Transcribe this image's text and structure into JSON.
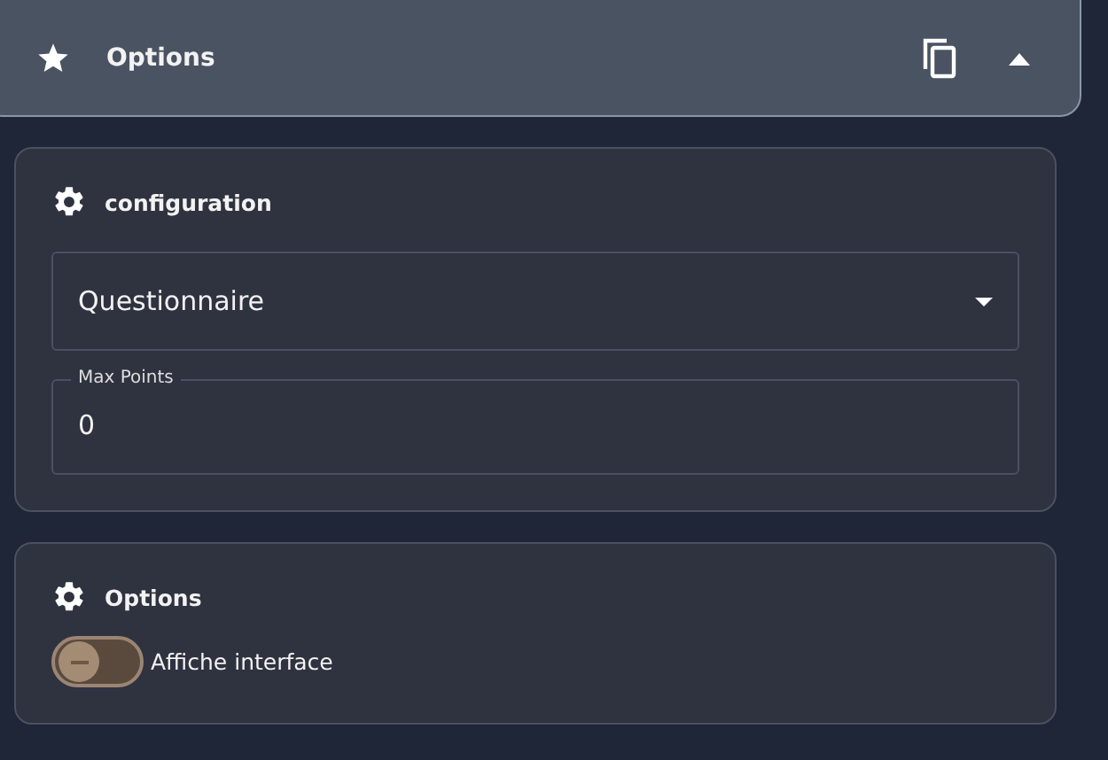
{
  "header": {
    "title": "Options",
    "expanded": true
  },
  "configuration": {
    "title": "configuration",
    "select": {
      "value": "Questionnaire"
    },
    "max_points": {
      "label": "Max Points",
      "value": "0"
    }
  },
  "options": {
    "title": "Options",
    "toggles": [
      {
        "label": "Affiche interface",
        "on": false
      }
    ]
  }
}
